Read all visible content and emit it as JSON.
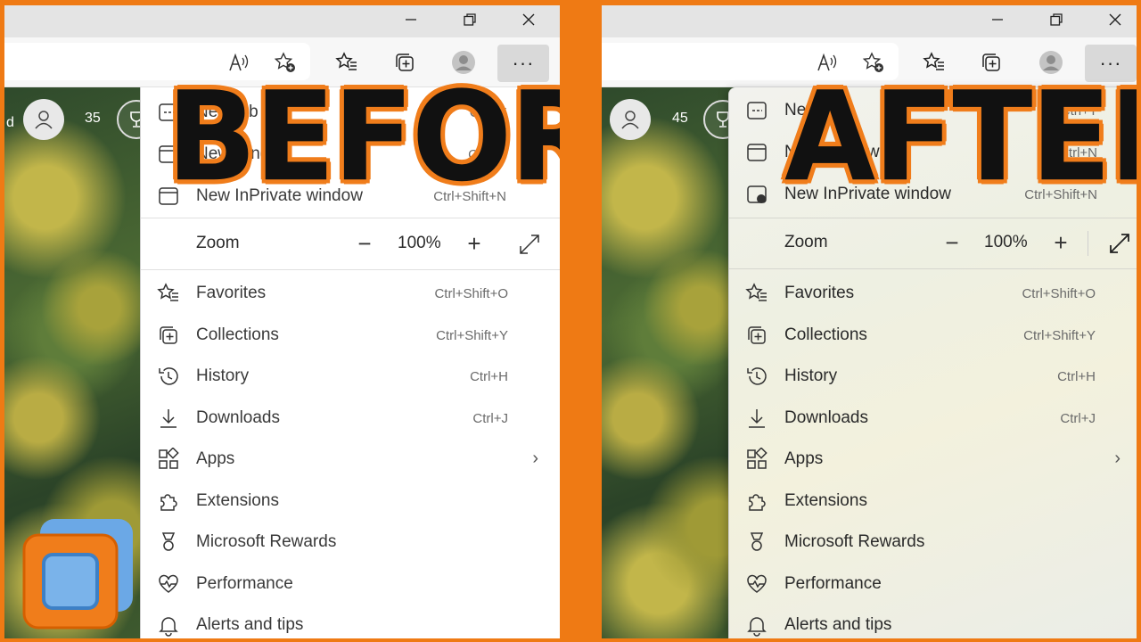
{
  "before": {
    "overlay_text": "BEFORE",
    "page_left_text": "d",
    "reward_count": "35",
    "menu": {
      "partial_items": [
        {
          "label": "New tab",
          "shortcut": "Ctrl+T"
        },
        {
          "label": "New window",
          "shortcut": "Ctrl+N"
        },
        {
          "label": "New InPrivate window",
          "shortcut": "Ctrl+Shift+N"
        }
      ],
      "zoom": {
        "label": "Zoom",
        "minus": "−",
        "value": "100%",
        "plus": "+"
      },
      "items": [
        {
          "label": "Favorites",
          "shortcut": "Ctrl+Shift+O",
          "icon": "favorites-icon"
        },
        {
          "label": "Collections",
          "shortcut": "Ctrl+Shift+Y",
          "icon": "collections-icon"
        },
        {
          "label": "History",
          "shortcut": "Ctrl+H",
          "icon": "history-icon"
        },
        {
          "label": "Downloads",
          "shortcut": "Ctrl+J",
          "icon": "downloads-icon"
        },
        {
          "label": "Apps",
          "shortcut": "",
          "icon": "apps-icon",
          "submenu": true
        },
        {
          "label": "Extensions",
          "shortcut": "",
          "icon": "extensions-icon"
        },
        {
          "label": "Microsoft Rewards",
          "shortcut": "",
          "icon": "rewards-icon"
        },
        {
          "label": "Performance",
          "shortcut": "",
          "icon": "performance-icon"
        },
        {
          "label": "Alerts and tips",
          "shortcut": "",
          "icon": "bell-icon"
        }
      ]
    }
  },
  "after": {
    "overlay_text": "AFTER",
    "reward_count": "45",
    "menu": {
      "partial_items": [
        {
          "label": "New tab",
          "shortcut": "Ctrl+T"
        },
        {
          "label": "New window",
          "shortcut": "Ctrl+N"
        },
        {
          "label": "New InPrivate window",
          "shortcut": "Ctrl+Shift+N"
        }
      ],
      "zoom": {
        "label": "Zoom",
        "minus": "−",
        "value": "100%",
        "plus": "+"
      },
      "items": [
        {
          "label": "Favorites",
          "shortcut": "Ctrl+Shift+O",
          "icon": "favorites-icon"
        },
        {
          "label": "Collections",
          "shortcut": "Ctrl+Shift+Y",
          "icon": "collections-icon"
        },
        {
          "label": "History",
          "shortcut": "Ctrl+H",
          "icon": "history-icon"
        },
        {
          "label": "Downloads",
          "shortcut": "Ctrl+J",
          "icon": "downloads-icon"
        },
        {
          "label": "Apps",
          "shortcut": "",
          "icon": "apps-icon",
          "submenu": true
        },
        {
          "label": "Extensions",
          "shortcut": "",
          "icon": "extensions-icon"
        },
        {
          "label": "Microsoft Rewards",
          "shortcut": "",
          "icon": "rewards-icon"
        },
        {
          "label": "Performance",
          "shortcut": "",
          "icon": "performance-icon"
        },
        {
          "label": "Alerts and tips",
          "shortcut": "",
          "icon": "bell-icon"
        }
      ]
    }
  },
  "toolbar": {
    "more_label": "···",
    "icons": [
      "read-aloud-icon",
      "add-favorite-icon",
      "favorites-icon",
      "collections-icon",
      "profile-icon",
      "more-icon"
    ]
  },
  "colors": {
    "frame": "#ef7a14",
    "overlay_text": "#111111",
    "overlay_outline": "#f07d1b"
  },
  "logo": "virtualbox-style-logo-icon"
}
